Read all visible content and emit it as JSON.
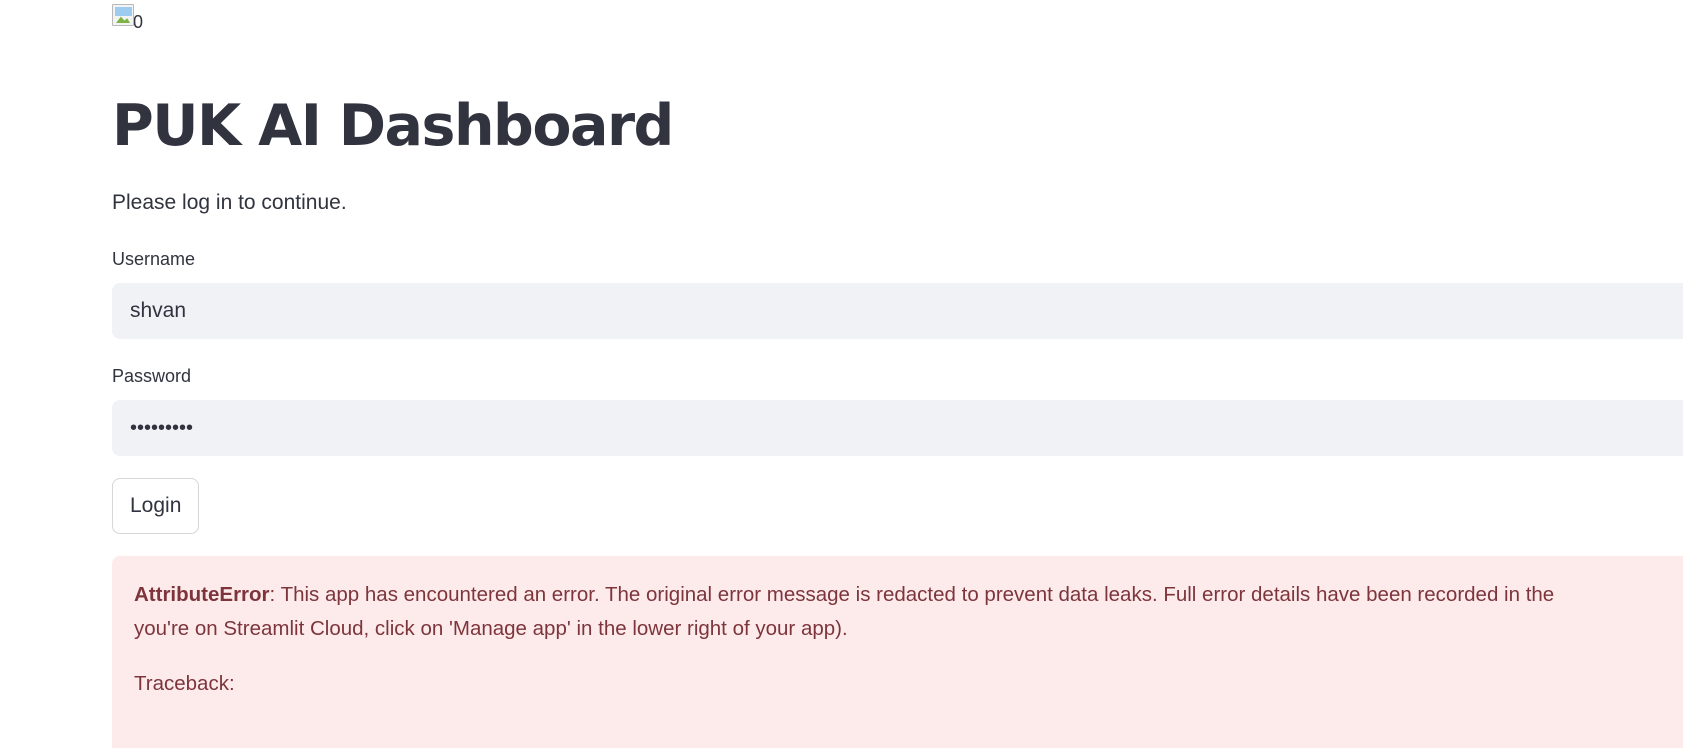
{
  "logo": {
    "alt_text": "0",
    "icon": "broken-image-icon"
  },
  "header": {
    "title": "PUK AI Dashboard",
    "subtitle": "Please log in to continue."
  },
  "form": {
    "username_label": "Username",
    "username_value": "shvan",
    "password_label": "Password",
    "password_value": "•••••••••",
    "login_label": "Login"
  },
  "error": {
    "name": "AttributeError",
    "message_line1": ": This app has encountered an error. The original error message is redacted to prevent data leaks. Full error details have been recorded in the",
    "message_line2": "you're on Streamlit Cloud, click on 'Manage app' in the lower right of your app).",
    "traceback_label": "Traceback:"
  },
  "colors": {
    "text": "#31333f",
    "input_bg": "#f0f2f6",
    "error_bg": "#fdebec",
    "error_text": "#7d353b",
    "button_border": "#d6d6d9"
  }
}
